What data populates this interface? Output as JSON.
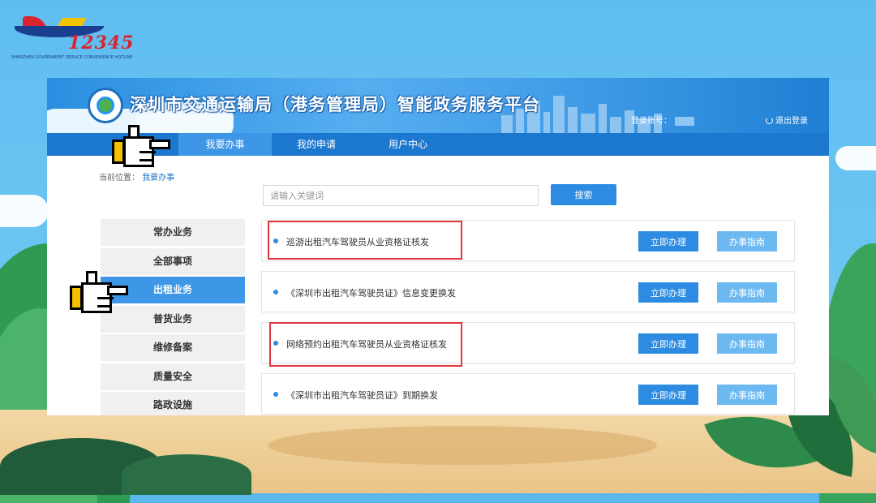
{
  "logo": {
    "number": "12345",
    "subtitle": "SHENZHEN GOVERNMENT SERVICE CONVENIENCE HOTLINE"
  },
  "header": {
    "site_title": "深圳市交通运输局（港务管理局）智能政务服务平台",
    "account_label": "登录账号：",
    "logout_label": "退出登录"
  },
  "nav": {
    "tabs": [
      {
        "label": "我要办事",
        "active": true
      },
      {
        "label": "我的申请",
        "active": false
      },
      {
        "label": "用户中心",
        "active": false
      }
    ]
  },
  "breadcrumb": {
    "prefix": "当前位置：",
    "current": "我要办事"
  },
  "search": {
    "placeholder": "请输入关键词",
    "button_label": "搜索"
  },
  "sidebar": {
    "items": [
      {
        "label": "常办业务",
        "active": false
      },
      {
        "label": "全部事项",
        "active": false
      },
      {
        "label": "出租业务",
        "active": true
      },
      {
        "label": "普货业务",
        "active": false
      },
      {
        "label": "维修备案",
        "active": false
      },
      {
        "label": "质量安全",
        "active": false
      },
      {
        "label": "路政设施",
        "active": false
      }
    ]
  },
  "services": {
    "do_label": "立即办理",
    "guide_label": "办事指南",
    "items": [
      {
        "name": "巡游出租汽车驾驶员从业资格证核发",
        "highlighted": true
      },
      {
        "name": "《深圳市出租汽车驾驶员证》信息变更换发",
        "highlighted": false
      },
      {
        "name": "网络预约出租汽车驾驶员从业资格证核发",
        "highlighted": true
      },
      {
        "name": "《深圳市出租汽车驾驶员证》到期换发",
        "highlighted": false
      }
    ]
  },
  "colors": {
    "primary": "#1c77cf",
    "button": "#2d8ce2",
    "guide_button": "#6cb9f1",
    "highlight": "#e0383f",
    "pointer_cuff": "#f2c200"
  }
}
